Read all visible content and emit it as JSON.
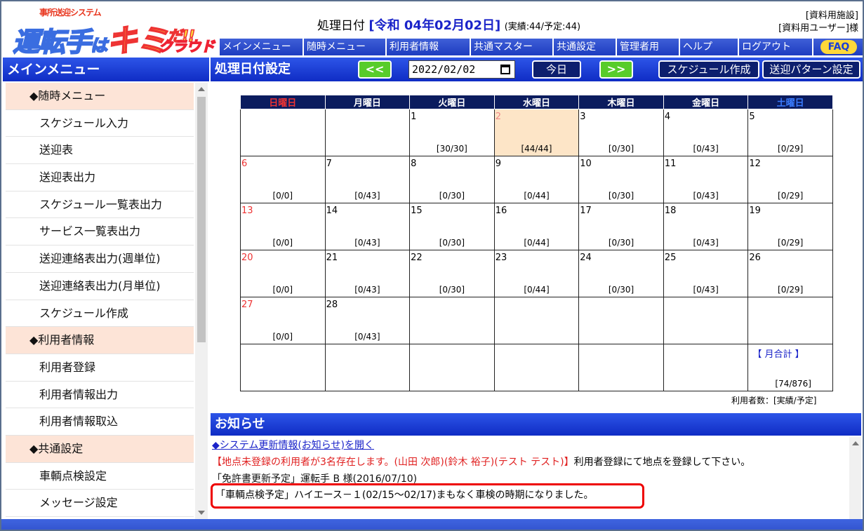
{
  "logo": {
    "sub": "事所送迎システム",
    "main_a": "運転手",
    "main_ha": "は",
    "main_kimi": "キミ",
    "main_da": "だ!!",
    "cloud": "クラウド"
  },
  "header": {
    "proc_label": "処理日付",
    "proc_era_date": "[令和 04年02月02日]",
    "proc_counts": "(実績:44/予定:44)",
    "facility": "[資料用施設]",
    "user": "[資料用ユーザー]様"
  },
  "nav": [
    "メインメニュー",
    "随時メニュー",
    "利用者情報",
    "共通マスター",
    "共通設定",
    "管理者用",
    "ヘルプ",
    "ログアウト"
  ],
  "faq": "FAQ",
  "sidebar": {
    "title": "メインメニュー",
    "items": [
      {
        "label": "◆随時メニュー",
        "section": true
      },
      {
        "label": "スケジュール入力"
      },
      {
        "label": "送迎表"
      },
      {
        "label": "送迎表出力"
      },
      {
        "label": "スケジュール一覧表出力"
      },
      {
        "label": "サービス一覧表出力"
      },
      {
        "label": "送迎連絡表出力(週単位)"
      },
      {
        "label": "送迎連絡表出力(月単位)"
      },
      {
        "label": "スケジュール作成"
      },
      {
        "label": "◆利用者情報",
        "section": true
      },
      {
        "label": "利用者登録"
      },
      {
        "label": "利用者情報出力"
      },
      {
        "label": "利用者情報取込"
      },
      {
        "label": "◆共通設定",
        "section": true
      },
      {
        "label": "車輌点検設定"
      },
      {
        "label": "メッセージ設定"
      }
    ]
  },
  "main": {
    "title": "処理日付設定",
    "prev": "<<",
    "next": ">>",
    "date_value": "2022/02/02",
    "today": "今日",
    "schedule_create": "スケジュール作成",
    "pattern_setting": "送迎パターン設定"
  },
  "calendar": {
    "weekdays": [
      "日曜日",
      "月曜日",
      "火曜日",
      "水曜日",
      "木曜日",
      "金曜日",
      "土曜日"
    ],
    "weeks": [
      [
        {
          "d": "",
          "c": ""
        },
        {
          "d": "",
          "c": ""
        },
        {
          "d": "1",
          "c": "[30/30]"
        },
        {
          "d": "2",
          "c": "[44/44]",
          "today": true
        },
        {
          "d": "3",
          "c": "[0/30]"
        },
        {
          "d": "4",
          "c": "[0/43]"
        },
        {
          "d": "5",
          "c": "[0/29]"
        }
      ],
      [
        {
          "d": "6",
          "c": "[0/0]"
        },
        {
          "d": "7",
          "c": "[0/43]"
        },
        {
          "d": "8",
          "c": "[0/30]"
        },
        {
          "d": "9",
          "c": "[0/44]"
        },
        {
          "d": "10",
          "c": "[0/30]"
        },
        {
          "d": "11",
          "c": "[0/43]"
        },
        {
          "d": "12",
          "c": "[0/29]"
        }
      ],
      [
        {
          "d": "13",
          "c": "[0/0]"
        },
        {
          "d": "14",
          "c": "[0/43]"
        },
        {
          "d": "15",
          "c": "[0/30]"
        },
        {
          "d": "16",
          "c": "[0/44]"
        },
        {
          "d": "17",
          "c": "[0/30]"
        },
        {
          "d": "18",
          "c": "[0/43]"
        },
        {
          "d": "19",
          "c": "[0/29]"
        }
      ],
      [
        {
          "d": "20",
          "c": "[0/0]"
        },
        {
          "d": "21",
          "c": "[0/43]"
        },
        {
          "d": "22",
          "c": "[0/30]"
        },
        {
          "d": "23",
          "c": "[0/44]"
        },
        {
          "d": "24",
          "c": "[0/30]"
        },
        {
          "d": "25",
          "c": "[0/43]"
        },
        {
          "d": "26",
          "c": "[0/29]"
        }
      ],
      [
        {
          "d": "27",
          "c": "[0/0]"
        },
        {
          "d": "28",
          "c": "[0/43]"
        },
        {
          "d": "",
          "c": ""
        },
        {
          "d": "",
          "c": ""
        },
        {
          "d": "",
          "c": ""
        },
        {
          "d": "",
          "c": ""
        },
        {
          "d": "",
          "c": ""
        }
      ]
    ],
    "month_label": "【 月合計 】",
    "month_count": "[74/876]",
    "users_legend": "利用者数：[実績/予定]"
  },
  "notices": {
    "title": "お知らせ",
    "link": "◆システム更新情報(お知らせ)を開く",
    "red": "【地点未登録の利用者が3名存在します。(山田 次郎)(鈴木 裕子)(テスト テスト)】",
    "red_suffix": "利用者登録にて地点を登録して下さい。",
    "license": "「免許書更新予定」運転手 B 様(2016/07/10)",
    "vehicle": "「車輌点検予定」ハイエース－１(02/15～02/17)まもなく車検の時期になりました。"
  },
  "colors": {
    "header_blue": "#1d3cc0",
    "section_bg": "#fde4d7",
    "today_bg": "#fde5c7",
    "sunday": "#e33",
    "saturday": "#3a7cff"
  }
}
